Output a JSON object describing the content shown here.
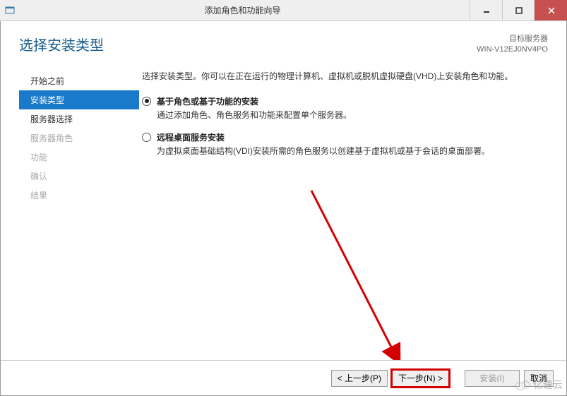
{
  "titlebar": {
    "title": "添加角色和功能向导"
  },
  "header": {
    "heading": "选择安装类型",
    "dest_label": "目标服务器",
    "dest_value": "WIN-V12EJ0NV4PO"
  },
  "sidebar": {
    "items": [
      {
        "label": "开始之前",
        "state": "normal"
      },
      {
        "label": "安装类型",
        "state": "active"
      },
      {
        "label": "服务器选择",
        "state": "normal"
      },
      {
        "label": "服务器角色",
        "state": "disabled"
      },
      {
        "label": "功能",
        "state": "disabled"
      },
      {
        "label": "确认",
        "state": "disabled"
      },
      {
        "label": "结果",
        "state": "disabled"
      }
    ]
  },
  "content": {
    "intro": "选择安装类型。你可以在正在运行的物理计算机、虚拟机或脱机虚拟硬盘(VHD)上安装角色和功能。",
    "options": [
      {
        "title": "基于角色或基于功能的安装",
        "desc": "通过添加角色、角色服务和功能来配置单个服务器。",
        "selected": true
      },
      {
        "title": "远程桌面服务安装",
        "desc": "为虚拟桌面基础结构(VDI)安装所需的角色服务以创建基于虚拟机或基于会话的桌面部署。",
        "selected": false
      }
    ]
  },
  "footer": {
    "prev": "< 上一步(P)",
    "next": "下一步(N) >",
    "install": "安装(I)",
    "cancel": "取消"
  },
  "watermark": "亿速云"
}
